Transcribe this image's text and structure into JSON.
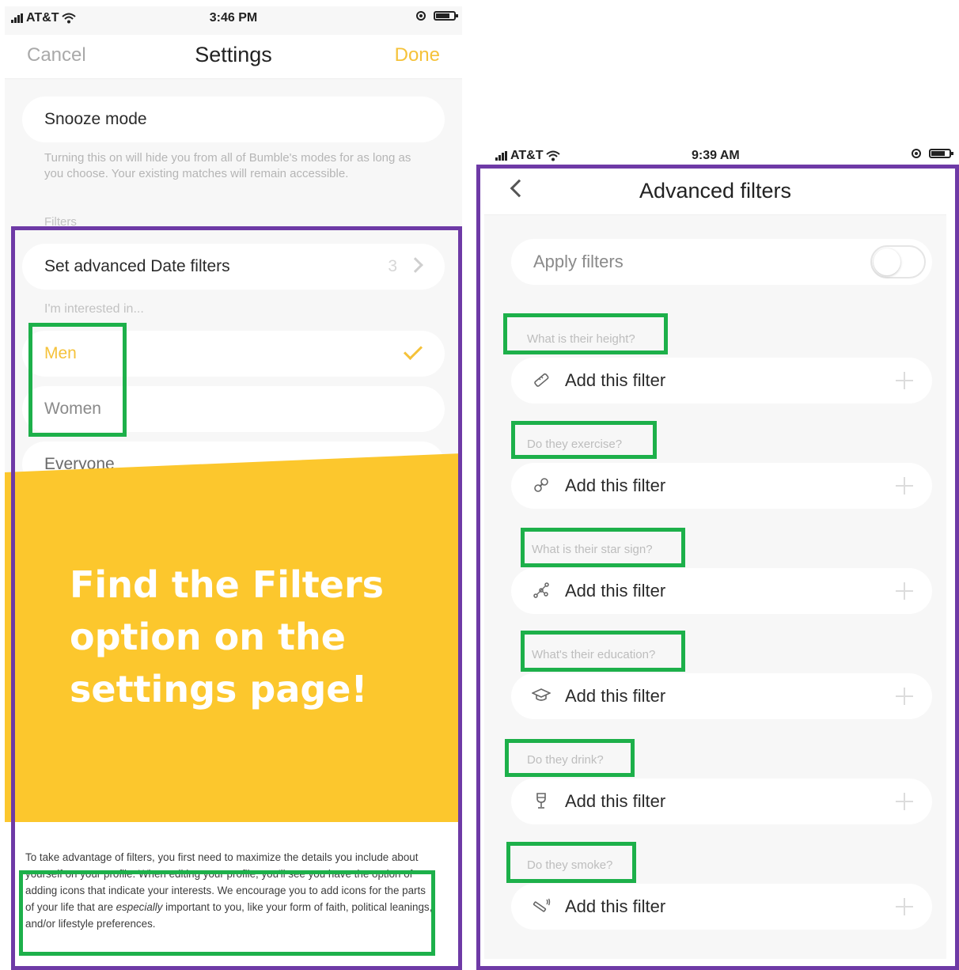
{
  "left": {
    "status": {
      "carrier": "AT&T",
      "time": "3:46 PM"
    },
    "nav": {
      "cancel": "Cancel",
      "title": "Settings",
      "done": "Done"
    },
    "snooze": {
      "label": "Snooze mode",
      "description": "Turning this on will hide you from all of Bumble's modes for as long as you choose. Your existing matches will remain accessible."
    },
    "filters_label": "Filters",
    "advanced": {
      "label": "Set advanced Date filters",
      "count": "3"
    },
    "interested_label": "I'm interested in...",
    "options": {
      "men": "Men",
      "women": "Women",
      "everyone": "Everyone"
    },
    "headline": "Find the Filters option on the settings page!",
    "caption": {
      "part1": "To take advantage of filters, you first need to maximize the details you include about yourself on your profile. When editing your profile, you'll see you have the option of adding icons that indicate your interests. We encourage you to add icons for the parts of your life that are ",
      "emphasis": "especially",
      "part2": " important to you, like your form of faith, political leanings, and/or lifestyle preferences."
    }
  },
  "right": {
    "status": {
      "carrier": "AT&T",
      "time": "9:39 AM"
    },
    "title": "Advanced filters",
    "apply_label": "Apply filters",
    "filters": [
      {
        "question": "What is their height?",
        "action": "Add this filter",
        "icon": "ruler-icon"
      },
      {
        "question": "Do they exercise?",
        "action": "Add this filter",
        "icon": "exercise-icon"
      },
      {
        "question": "What is their star sign?",
        "action": "Add this filter",
        "icon": "star-sign-icon"
      },
      {
        "question": "What's their education?",
        "action": "Add this filter",
        "icon": "graduation-cap-icon"
      },
      {
        "question": "Do they drink?",
        "action": "Add this filter",
        "icon": "wine-glass-icon"
      },
      {
        "question": "Do they smoke?",
        "action": "Add this filter",
        "icon": "smoking-icon"
      }
    ]
  },
  "colors": {
    "accent": "#f5c23a",
    "banner": "#fcc72d",
    "outline_purple": "#6e3aa6",
    "outline_green": "#1db04a"
  }
}
